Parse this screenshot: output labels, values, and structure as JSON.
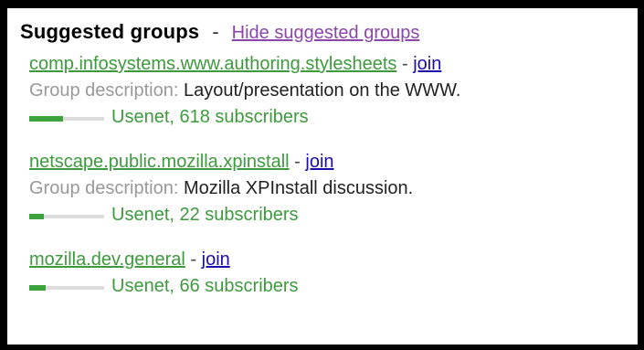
{
  "header": {
    "title": "Suggested groups",
    "separator": "-",
    "hide_link": "Hide suggested groups"
  },
  "colors": {
    "group_link": "#3d9a3d",
    "join_link": "#1a0dab",
    "visited_link": "#8a46a8",
    "activity_fill": "#3ca33c"
  },
  "groups": [
    {
      "name": "comp.infosystems.www.authoring.stylesheets",
      "separator": "-",
      "join": "join",
      "description_label": "Group description:",
      "description": "Layout/presentation on the WWW.",
      "stats": "Usenet, 618 subscribers",
      "activity": 0.45
    },
    {
      "name": "netscape.public.mozilla.xpinstall",
      "separator": "-",
      "join": "join",
      "description_label": "Group description:",
      "description": "Mozilla XPInstall discussion.",
      "stats": "Usenet, 22 subscribers",
      "activity": 0.2
    },
    {
      "name": "mozilla.dev.general",
      "separator": "-",
      "join": "join",
      "stats": "Usenet, 66 subscribers",
      "activity": 0.22
    }
  ]
}
